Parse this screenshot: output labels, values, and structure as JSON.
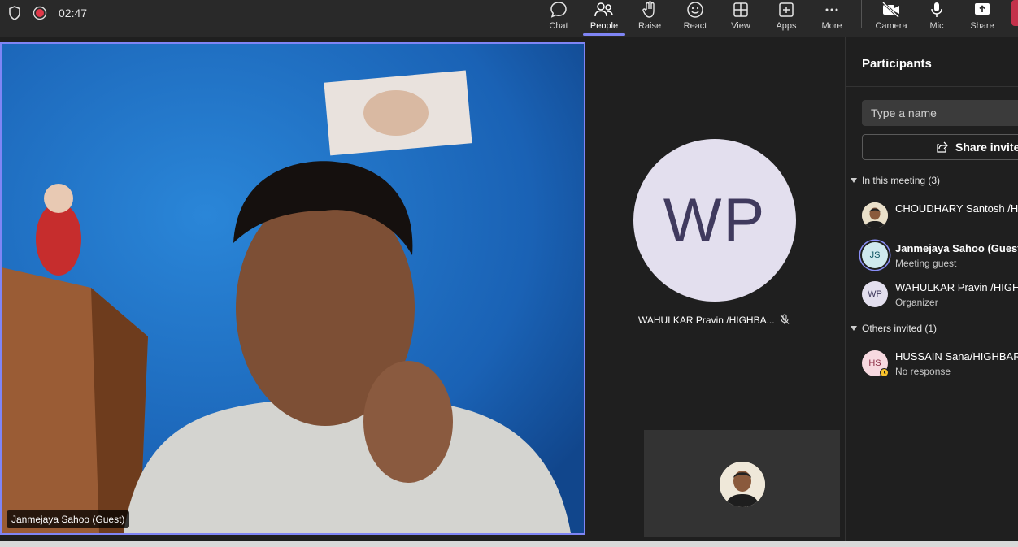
{
  "topbar": {
    "timer": "02:47",
    "tools": [
      {
        "label": "Chat",
        "icon": "chat-icon"
      },
      {
        "label": "People",
        "icon": "people-icon"
      },
      {
        "label": "Raise",
        "icon": "raise-hand-icon"
      },
      {
        "label": "React",
        "icon": "react-smiley-icon"
      },
      {
        "label": "View",
        "icon": "view-grid-icon"
      },
      {
        "label": "Apps",
        "icon": "apps-plus-icon"
      },
      {
        "label": "More",
        "icon": "more-dots-icon"
      }
    ],
    "devices": [
      {
        "label": "Camera",
        "icon": "camera-off-icon"
      },
      {
        "label": "Mic",
        "icon": "mic-icon"
      },
      {
        "label": "Share",
        "icon": "share-screen-icon"
      }
    ]
  },
  "stage": {
    "main_video_name": "Janmejaya Sahoo (Guest)",
    "tile_initials": "WP",
    "tile_name": "WAHULKAR Pravin /HIGHBA..."
  },
  "panel": {
    "title": "Participants",
    "search_placeholder": "Type a name",
    "share_invite": "Share invite",
    "in_meeting_header": "In this meeting (3)",
    "others_header": "Others invited (1)",
    "in_meeting": [
      {
        "name": "CHOUDHARY Santosh /H",
        "sub": "",
        "initials": ""
      },
      {
        "name": "Janmejaya Sahoo (Guest",
        "sub": "Meeting guest",
        "initials": "JS"
      },
      {
        "name": "WAHULKAR Pravin /HIGH",
        "sub": "Organizer",
        "initials": "WP"
      }
    ],
    "others": [
      {
        "name": "HUSSAIN Sana/HIGHBAR",
        "sub": "No response",
        "initials": "HS"
      }
    ]
  },
  "colors": {
    "accent": "#7f85f5",
    "leave": "#c4314b"
  }
}
